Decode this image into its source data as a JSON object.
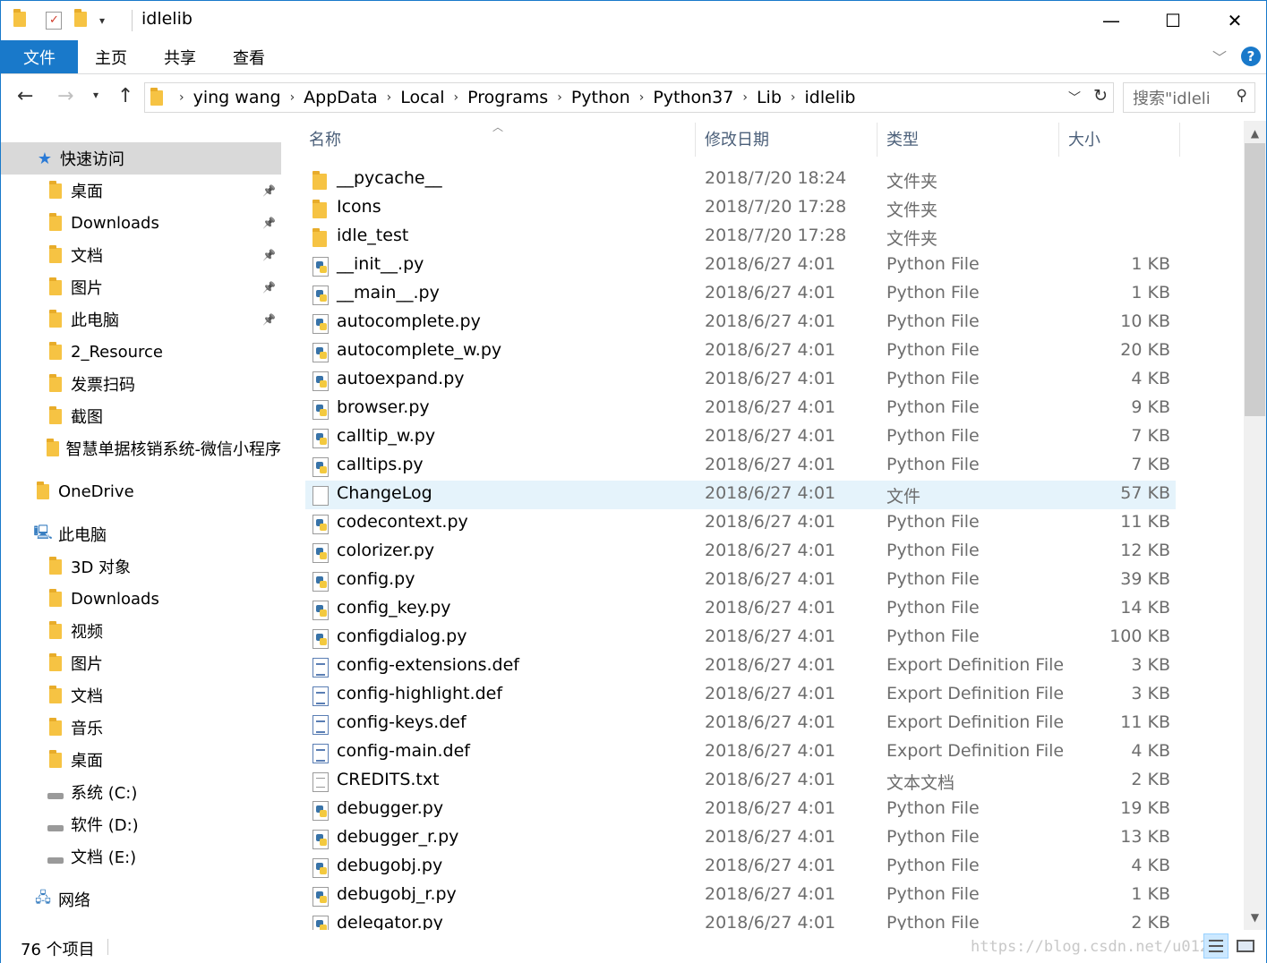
{
  "window": {
    "title": "idlelib",
    "accent": "#1979ca",
    "minimize": "—",
    "maximize": "☐",
    "close": "✕"
  },
  "ribbon": {
    "tabs": [
      {
        "label": "文件"
      },
      {
        "label": "主页"
      },
      {
        "label": "共享"
      },
      {
        "label": "查看"
      }
    ],
    "help_label": "?"
  },
  "address": {
    "path": [
      "ying wang",
      "AppData",
      "Local",
      "Programs",
      "Python",
      "Python37",
      "Lib",
      "idlelib"
    ],
    "search_placeholder": "搜索\"idleli"
  },
  "navpane": {
    "quick_access": "快速访问",
    "quick_items": [
      {
        "label": "桌面",
        "icon": "desktop-folder-icon",
        "pinned": true
      },
      {
        "label": "Downloads",
        "icon": "downloads-folder-icon",
        "pinned": true
      },
      {
        "label": "文档",
        "icon": "documents-folder-icon",
        "pinned": true
      },
      {
        "label": "图片",
        "icon": "pictures-folder-icon",
        "pinned": true
      },
      {
        "label": "此电脑",
        "icon": "computer-icon",
        "pinned": true
      },
      {
        "label": "2_Resource",
        "icon": "folder-icon",
        "pinned": false
      },
      {
        "label": "发票扫码",
        "icon": "folder-icon",
        "pinned": false
      },
      {
        "label": "截图",
        "icon": "folder-icon",
        "pinned": false
      },
      {
        "label": "智慧单据核销系统-微信小程序",
        "icon": "folder-icon",
        "pinned": false
      }
    ],
    "onedrive": "OneDrive",
    "this_pc": "此电脑",
    "pc_items": [
      {
        "label": "3D 对象",
        "icon": "3d-objects-folder-icon"
      },
      {
        "label": "Downloads",
        "icon": "downloads-folder-icon"
      },
      {
        "label": "视频",
        "icon": "videos-folder-icon"
      },
      {
        "label": "图片",
        "icon": "pictures-folder-icon"
      },
      {
        "label": "文档",
        "icon": "documents-folder-icon"
      },
      {
        "label": "音乐",
        "icon": "music-folder-icon"
      },
      {
        "label": "桌面",
        "icon": "desktop-folder-icon"
      },
      {
        "label": "系统 (C:)",
        "icon": "system-drive-icon"
      },
      {
        "label": "软件 (D:)",
        "icon": "drive-icon"
      },
      {
        "label": "文档 (E:)",
        "icon": "drive-icon"
      }
    ],
    "network": "网络"
  },
  "columns": {
    "name": "名称",
    "date": "修改日期",
    "type": "类型",
    "size": "大小"
  },
  "files": [
    {
      "name": "__pycache__",
      "date": "2018/7/20 18:24",
      "type": "文件夹",
      "size": "",
      "icon": "folder"
    },
    {
      "name": "Icons",
      "date": "2018/7/20 17:28",
      "type": "文件夹",
      "size": "",
      "icon": "folder"
    },
    {
      "name": "idle_test",
      "date": "2018/7/20 17:28",
      "type": "文件夹",
      "size": "",
      "icon": "folder"
    },
    {
      "name": "__init__.py",
      "date": "2018/6/27 4:01",
      "type": "Python File",
      "size": "1 KB",
      "icon": "python"
    },
    {
      "name": "__main__.py",
      "date": "2018/6/27 4:01",
      "type": "Python File",
      "size": "1 KB",
      "icon": "python"
    },
    {
      "name": "autocomplete.py",
      "date": "2018/6/27 4:01",
      "type": "Python File",
      "size": "10 KB",
      "icon": "python"
    },
    {
      "name": "autocomplete_w.py",
      "date": "2018/6/27 4:01",
      "type": "Python File",
      "size": "20 KB",
      "icon": "python"
    },
    {
      "name": "autoexpand.py",
      "date": "2018/6/27 4:01",
      "type": "Python File",
      "size": "4 KB",
      "icon": "python"
    },
    {
      "name": "browser.py",
      "date": "2018/6/27 4:01",
      "type": "Python File",
      "size": "9 KB",
      "icon": "python"
    },
    {
      "name": "calltip_w.py",
      "date": "2018/6/27 4:01",
      "type": "Python File",
      "size": "7 KB",
      "icon": "python"
    },
    {
      "name": "calltips.py",
      "date": "2018/6/27 4:01",
      "type": "Python File",
      "size": "7 KB",
      "icon": "python"
    },
    {
      "name": "ChangeLog",
      "date": "2018/6/27 4:01",
      "type": "文件",
      "size": "57 KB",
      "icon": "doc",
      "highlight": true
    },
    {
      "name": "codecontext.py",
      "date": "2018/6/27 4:01",
      "type": "Python File",
      "size": "11 KB",
      "icon": "python"
    },
    {
      "name": "colorizer.py",
      "date": "2018/6/27 4:01",
      "type": "Python File",
      "size": "12 KB",
      "icon": "python"
    },
    {
      "name": "config.py",
      "date": "2018/6/27 4:01",
      "type": "Python File",
      "size": "39 KB",
      "icon": "python"
    },
    {
      "name": "config_key.py",
      "date": "2018/6/27 4:01",
      "type": "Python File",
      "size": "14 KB",
      "icon": "python"
    },
    {
      "name": "configdialog.py",
      "date": "2018/6/27 4:01",
      "type": "Python File",
      "size": "100 KB",
      "icon": "python"
    },
    {
      "name": "config-extensions.def",
      "date": "2018/6/27 4:01",
      "type": "Export Definition File",
      "size": "3 KB",
      "icon": "def"
    },
    {
      "name": "config-highlight.def",
      "date": "2018/6/27 4:01",
      "type": "Export Definition File",
      "size": "3 KB",
      "icon": "def"
    },
    {
      "name": "config-keys.def",
      "date": "2018/6/27 4:01",
      "type": "Export Definition File",
      "size": "11 KB",
      "icon": "def"
    },
    {
      "name": "config-main.def",
      "date": "2018/6/27 4:01",
      "type": "Export Definition File",
      "size": "4 KB",
      "icon": "def"
    },
    {
      "name": "CREDITS.txt",
      "date": "2018/6/27 4:01",
      "type": "文本文档",
      "size": "2 KB",
      "icon": "txt"
    },
    {
      "name": "debugger.py",
      "date": "2018/6/27 4:01",
      "type": "Python File",
      "size": "19 KB",
      "icon": "python"
    },
    {
      "name": "debugger_r.py",
      "date": "2018/6/27 4:01",
      "type": "Python File",
      "size": "13 KB",
      "icon": "python"
    },
    {
      "name": "debugobj.py",
      "date": "2018/6/27 4:01",
      "type": "Python File",
      "size": "4 KB",
      "icon": "python"
    },
    {
      "name": "debugobj_r.py",
      "date": "2018/6/27 4:01",
      "type": "Python File",
      "size": "1 KB",
      "icon": "python"
    },
    {
      "name": "delegator.py",
      "date": "2018/6/27 4:01",
      "type": "Python File",
      "size": "2 KB",
      "icon": "python"
    }
  ],
  "status": {
    "count": "76 个项目",
    "watermark": "https://blog.csdn.net/u012"
  }
}
